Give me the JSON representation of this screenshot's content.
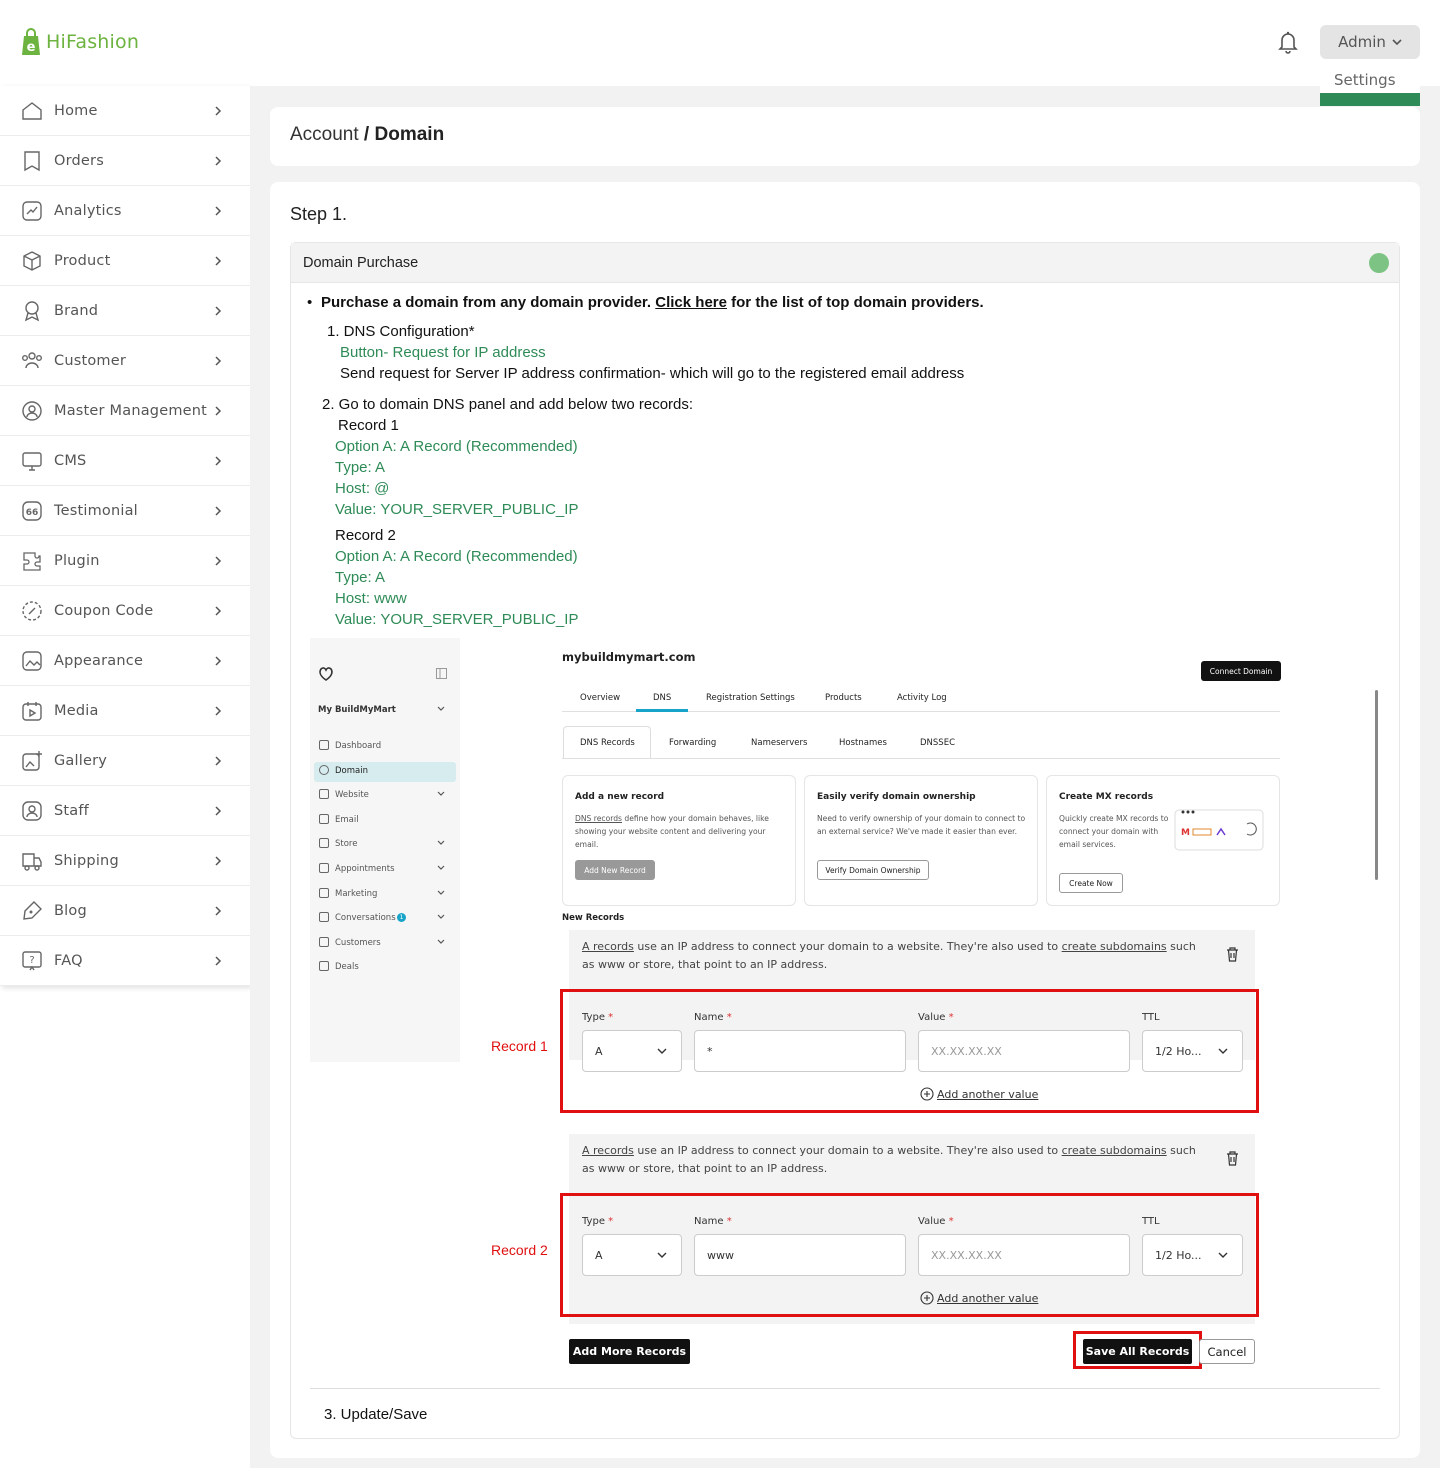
{
  "brand": {
    "name": "HiFashion",
    "accent": "#6db33f",
    "logo_letter": "e"
  },
  "header": {
    "admin_label": "Admin",
    "admin_menu_item": "Settings"
  },
  "sidebar": {
    "items": [
      {
        "label": "Home",
        "icon": "home-icon"
      },
      {
        "label": "Orders",
        "icon": "orders-icon"
      },
      {
        "label": "Analytics",
        "icon": "analytics-icon"
      },
      {
        "label": "Product",
        "icon": "product-icon"
      },
      {
        "label": "Brand",
        "icon": "brand-icon"
      },
      {
        "label": "Customer",
        "icon": "customer-icon"
      },
      {
        "label": "Master Management",
        "icon": "master-management-icon"
      },
      {
        "label": "CMS",
        "icon": "cms-icon"
      },
      {
        "label": "Testimonial",
        "icon": "testimonial-icon"
      },
      {
        "label": "Plugin",
        "icon": "plugin-icon"
      },
      {
        "label": "Coupon Code",
        "icon": "coupon-icon"
      },
      {
        "label": "Appearance",
        "icon": "appearance-icon"
      },
      {
        "label": "Media",
        "icon": "media-icon"
      },
      {
        "label": "Gallery",
        "icon": "gallery-icon"
      },
      {
        "label": "Staff",
        "icon": "staff-icon"
      },
      {
        "label": "Shipping",
        "icon": "shipping-icon"
      },
      {
        "label": "Blog",
        "icon": "blog-icon"
      },
      {
        "label": "FAQ",
        "icon": "faq-icon"
      }
    ]
  },
  "breadcrumb": {
    "parent": "Account",
    "separator": " / ",
    "current": "Domain"
  },
  "step": {
    "title": "Step 1."
  },
  "domain_purchase": {
    "title": "Domain Purchase",
    "bullet_text": "Purchase a domain from any domain provider. ",
    "link_text": "Click here",
    "bullet_tail": " for the list of top domain providers.",
    "dns_config": "1. DNS Configuration*",
    "request_button": "Button- Request for IP address",
    "request_desc": "Send request for Server IP address confirmation- which will go to the registered email address",
    "step2": "2. Go to domain DNS panel and add below two records:",
    "record1": {
      "title": "Record 1",
      "option": "Option A: A Record (Recommended)",
      "type": "Type: A",
      "host": "Host: @",
      "value": "Value: YOUR_SERVER_PUBLIC_IP"
    },
    "record2": {
      "title": "Record 2",
      "option": "Option A: A Record (Recommended)",
      "type": "Type: A",
      "host": "Host: www",
      "value": "Value: YOUR_SERVER_PUBLIC_IP"
    },
    "step3": "3. Update/Save"
  },
  "screenshot": {
    "site_name": "My BuildMyMart",
    "nav": [
      "Dashboard",
      "Domain",
      "Website",
      "Email",
      "Store",
      "Appointments",
      "Marketing",
      "Conversations",
      "Customers",
      "Deals"
    ],
    "conversations_badge": "1",
    "domain": "mybuildmymart.com",
    "connect_button": "Connect Domain",
    "tabs": [
      "Overview",
      "DNS",
      "Registration Settings",
      "Products",
      "Activity Log"
    ],
    "subtabs": [
      "DNS Records",
      "Forwarding",
      "Nameservers",
      "Hostnames",
      "DNSSEC"
    ],
    "card1": {
      "title": "Add a new record",
      "link": "DNS records",
      "text": " define how your domain behaves, like showing your website content and delivering your email.",
      "button": "Add New Record"
    },
    "card2": {
      "title": "Easily verify domain ownership",
      "text": "Need to verify ownership of your domain to connect to an external service? We've made it easier than ever.",
      "button": "Verify Domain Ownership"
    },
    "card3": {
      "title": "Create MX records",
      "text": "Quickly create MX records to connect your domain with email services.",
      "button": "Create Now"
    },
    "new_records": "New Records",
    "record_info": {
      "link1": "A records",
      "mid": " use an IP address to connect your domain to a website. They're also used to ",
      "link2": "create subdomains",
      "tail": " such as www or store, that point to an IP address."
    },
    "fields": {
      "type": "Type",
      "name": "Name",
      "value": "Value",
      "ttl": "TTL"
    },
    "records": [
      {
        "label": "Record 1",
        "type": "A",
        "name": "*",
        "value_placeholder": "XX.XX.XX.XX",
        "ttl": "1/2 Ho..."
      },
      {
        "label": "Record 2",
        "type": "A",
        "name": "www",
        "value_placeholder": "XX.XX.XX.XX",
        "ttl": "1/2 Ho..."
      }
    ],
    "add_value": "Add another value",
    "add_more": "Add More Records",
    "save_all": "Save All Records",
    "cancel": "Cancel"
  },
  "colors": {
    "green_text": "#2e8b57",
    "highlight": "#e01010",
    "active_tab": "#18a4c8"
  }
}
